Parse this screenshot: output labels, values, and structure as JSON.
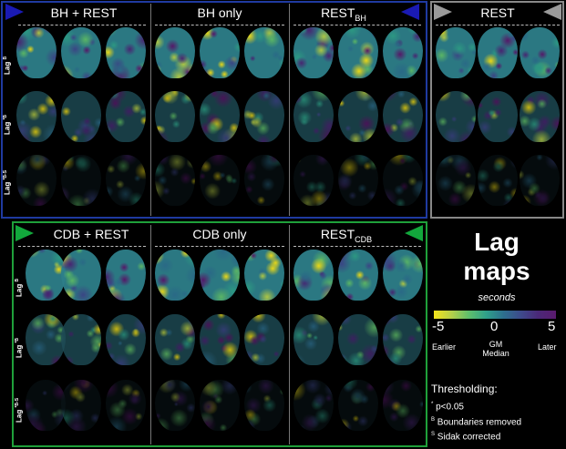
{
  "top_left_panel": {
    "columns": [
      {
        "label": "BH + REST"
      },
      {
        "label": "BH only"
      },
      {
        "label_main": "REST",
        "label_sub": "BH"
      }
    ],
    "row_labels": [
      {
        "main": "Lag",
        "sup": "B"
      },
      {
        "main": "Lag",
        "sup": "*B"
      },
      {
        "main": "Lag",
        "sup": "*B-S"
      }
    ]
  },
  "top_right_panel": {
    "columns": [
      {
        "label": "REST"
      }
    ]
  },
  "bottom_panel": {
    "columns": [
      {
        "label": "CDB + REST"
      },
      {
        "label": "CDB only"
      },
      {
        "label_main": "REST",
        "label_sub": "CDB"
      }
    ],
    "row_labels": [
      {
        "main": "Lag",
        "sup": "B"
      },
      {
        "main": "Lag",
        "sup": "*B"
      },
      {
        "main": "Lag",
        "sup": "*B-S"
      }
    ]
  },
  "legend": {
    "title_line1": "Lag",
    "title_line2": "maps",
    "units": "seconds",
    "tick_min": "-5",
    "tick_mid": "0",
    "tick_max": "5",
    "label_left": "Earlier",
    "label_mid_1": "GM",
    "label_mid_2": "Median",
    "label_right": "Later",
    "colormap": [
      "#f5e31a",
      "#b6d04a",
      "#5fbf6b",
      "#2fa08a",
      "#2d6f8e",
      "#3e4a8c",
      "#4b2878",
      "#5a1a6e"
    ]
  },
  "thresholding": {
    "title": "Thresholding:",
    "items": [
      {
        "symbol": "*",
        "text": "p<0.05"
      },
      {
        "symbol": "B",
        "text": "Boundaries removed"
      },
      {
        "symbol": "S",
        "text": "Sidak corrected"
      }
    ]
  },
  "colors": {
    "blue_frame": "#1f3aa0",
    "green_frame": "#1fa03a",
    "gray_frame": "#888888",
    "arrow_blue": "#1a1ab4",
    "arrow_green": "#12a83c",
    "arrow_gray": "#9a9a9a"
  }
}
